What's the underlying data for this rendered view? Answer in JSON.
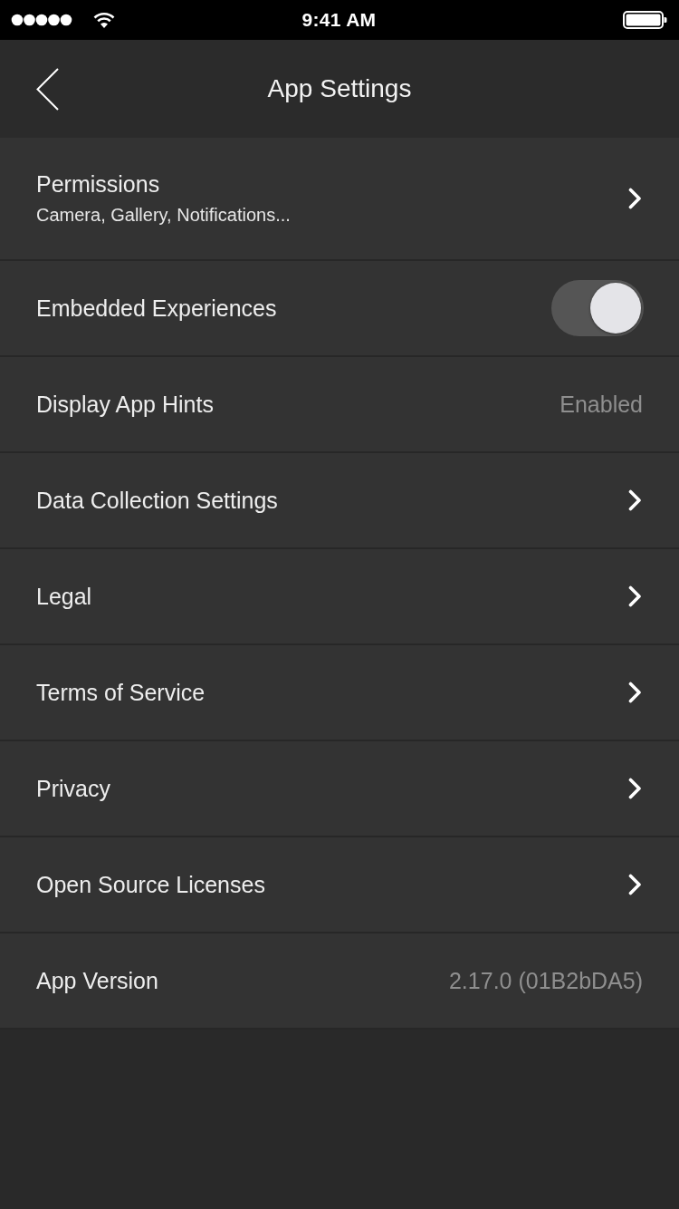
{
  "status_bar": {
    "time": "9:41 AM"
  },
  "header": {
    "title": "App Settings"
  },
  "items": [
    {
      "kind": "nav",
      "label": "Permissions",
      "subtitle": "Camera, Gallery, Notifications..."
    },
    {
      "kind": "toggle",
      "label": "Embedded Experiences",
      "on": true
    },
    {
      "kind": "value",
      "label": "Display App Hints",
      "value": "Enabled"
    },
    {
      "kind": "nav",
      "label": "Data Collection Settings"
    },
    {
      "kind": "nav",
      "label": "Legal"
    },
    {
      "kind": "nav",
      "label": "Terms of Service"
    },
    {
      "kind": "nav",
      "label": "Privacy"
    },
    {
      "kind": "nav",
      "label": "Open Source Licenses"
    },
    {
      "kind": "value",
      "label": "App Version",
      "value": "2.17.0 (01B2bDA5)"
    }
  ]
}
